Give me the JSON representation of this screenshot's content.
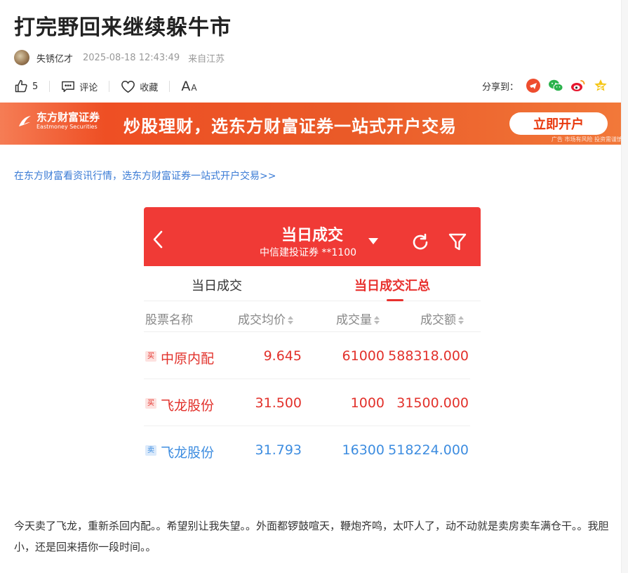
{
  "article": {
    "title": "打完野回来继续躲牛市",
    "author": "失锈亿才",
    "time": "2025-08-18 12:43:49",
    "location": "来自江苏",
    "body": "今天卖了飞龙，重新杀回内配。。希望别让我失望。。外面都锣鼓喧天，鞭炮齐鸣，太吓人了，动不动就是卖房卖车满仓干。。我胆小，还是回来捂你一段时间。。"
  },
  "actions": {
    "like_count": "5",
    "comment_label": "评论",
    "favorite_label": "收藏",
    "font_big": "A",
    "font_small": "A",
    "share_label": "分享到："
  },
  "banner": {
    "brand_cn": "东方财富证券",
    "brand_en": "Eastmoney Securities",
    "slogan": "炒股理财，选东方财富证券一站式开户交易",
    "cta": "立即开户",
    "note": "广告 市场有风险 投资需谨慎"
  },
  "promo_link": "在东方财富看资讯行情，选东方财富证券一站式开户交易>>",
  "screenshot": {
    "title": "当日成交",
    "subtitle": "中信建投证券 **1100",
    "tabs": [
      "当日成交",
      "当日成交汇总"
    ],
    "columns": [
      "股票名称",
      "成交均价",
      "成交量",
      "成交额"
    ],
    "rows": [
      {
        "tag": "买",
        "side": "buy",
        "name": "中原内配",
        "price": "9.645",
        "volume": "61000",
        "amount": "588318.000"
      },
      {
        "tag": "买",
        "side": "buy",
        "name": "飞龙股份",
        "price": "31.500",
        "volume": "1000",
        "amount": "31500.000"
      },
      {
        "tag": "卖",
        "side": "sell",
        "name": "飞龙股份",
        "price": "31.793",
        "volume": "16300",
        "amount": "518224.000"
      }
    ]
  },
  "colors": {
    "brand_red": "#f03a36",
    "buy_red": "#e2312b",
    "sell_blue": "#3e8de0",
    "link_blue": "#3a7bd5"
  }
}
